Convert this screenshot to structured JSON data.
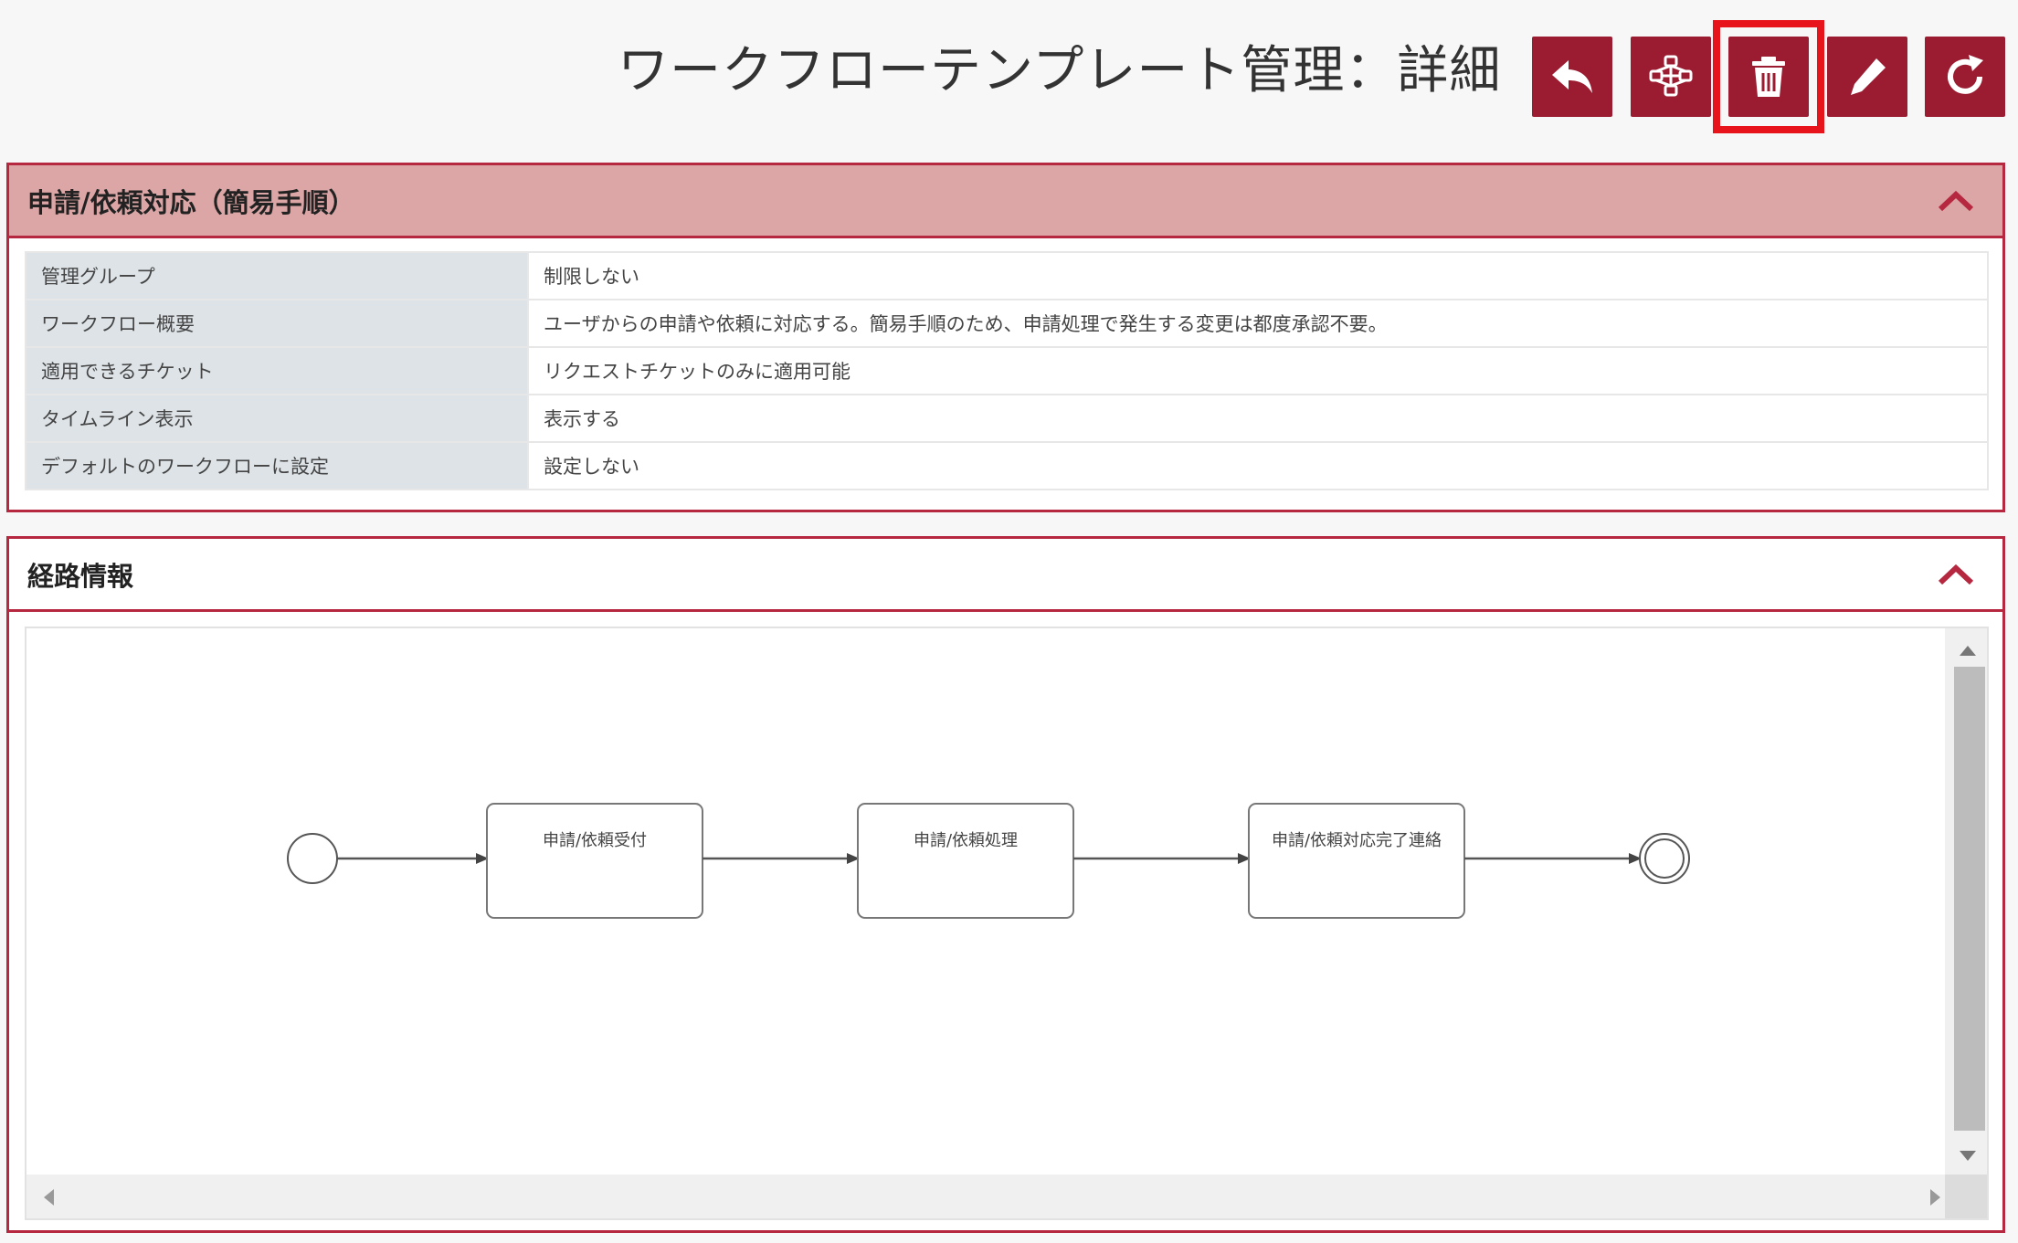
{
  "page": {
    "title": "ワークフローテンプレート管理：詳細"
  },
  "toolbar": {
    "buttons": [
      {
        "name": "back-button",
        "icon": "back-arrow-icon"
      },
      {
        "name": "workflow-button",
        "icon": "network-icon"
      },
      {
        "name": "delete-button",
        "icon": "trash-icon",
        "highlighted": true
      },
      {
        "name": "edit-button",
        "icon": "pencil-icon"
      },
      {
        "name": "refresh-button",
        "icon": "refresh-icon"
      }
    ],
    "accent_color": "#9b1b30",
    "highlight_color": "#e8141c"
  },
  "summary_panel": {
    "title": "申請/依頼対応（簡易手順）",
    "rows": [
      {
        "label": "管理グループ",
        "value": "制限しない"
      },
      {
        "label": "ワークフロー概要",
        "value": "ユーザからの申請や依頼に対応する。簡易手順のため、申請処理で発生する変更は都度承認不要。"
      },
      {
        "label": "適用できるチケット",
        "value": "リクエストチケットのみに適用可能"
      },
      {
        "label": "タイムライン表示",
        "value": "表示する"
      },
      {
        "label": "デフォルトのワークフローに設定",
        "value": "設定しない"
      }
    ]
  },
  "route_panel": {
    "title": "経路情報",
    "steps": [
      "申請/依頼受付",
      "申請/依頼処理",
      "申請/依頼対応完了連絡"
    ]
  }
}
